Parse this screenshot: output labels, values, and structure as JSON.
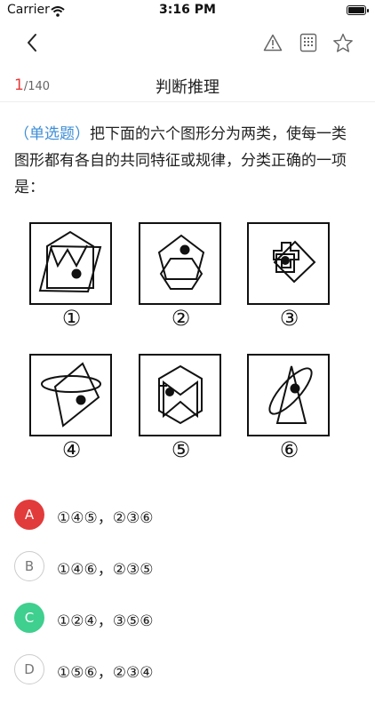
{
  "status": {
    "carrier": "Carrier",
    "time": "3:16 PM"
  },
  "header": {
    "counter_current": "1",
    "counter_total": "/140",
    "title": "判断推理"
  },
  "icons": {
    "back": "chevron-left-icon",
    "warn": "warning-icon",
    "grid": "answer-sheet-icon",
    "star": "star-icon"
  },
  "question": {
    "tag": "（单选题）",
    "text": "把下面的六个图形分为两类，使每一类图形都有各自的共同特征或规律，分类正确的一项是："
  },
  "figures": [
    "①",
    "②",
    "③",
    "④",
    "⑤",
    "⑥"
  ],
  "options": [
    {
      "letter": "A",
      "text": "①④⑤，②③⑥",
      "state": "wrong"
    },
    {
      "letter": "B",
      "text": "①④⑥，②③⑤",
      "state": "normal"
    },
    {
      "letter": "C",
      "text": "①②④，③⑤⑥",
      "state": "correct"
    },
    {
      "letter": "D",
      "text": "①⑤⑥，②③④",
      "state": "normal"
    }
  ],
  "colors": {
    "accent_red": "#e23b3b",
    "accent_green": "#3fcf8e",
    "tag_blue": "#3d8ed6"
  }
}
